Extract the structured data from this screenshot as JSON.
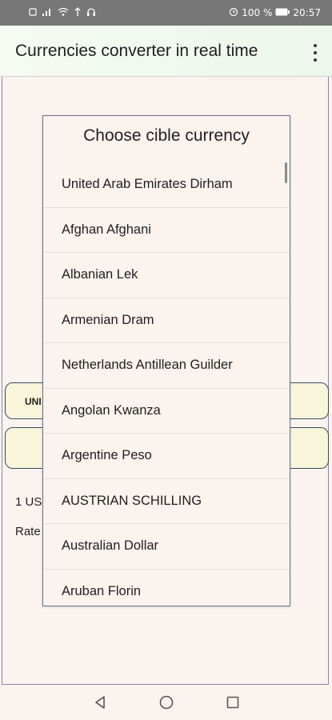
{
  "status_bar": {
    "left_icons": [
      "alarm-icon",
      "signal-icon",
      "wifi-icon",
      "usb-icon",
      "headset-icon"
    ],
    "battery": "100 %",
    "time": "20:57"
  },
  "app_bar": {
    "title": "Currencies converter in real time"
  },
  "background": {
    "field_1_label": "UNI",
    "line_1": "1 US",
    "line_2": "Rate"
  },
  "dialog": {
    "title": "Choose cible currency",
    "items": [
      "United Arab Emirates Dirham",
      "Afghan Afghani",
      "Albanian Lek",
      "Armenian Dram",
      "Netherlands Antillean Guilder",
      "Angolan Kwanza",
      "Argentine Peso",
      "AUSTRIAN SCHILLING",
      "Australian Dollar",
      "Aruban Florin"
    ]
  },
  "nav_bar": {
    "back": "back-icon",
    "home": "home-icon",
    "recents": "recents-icon"
  }
}
